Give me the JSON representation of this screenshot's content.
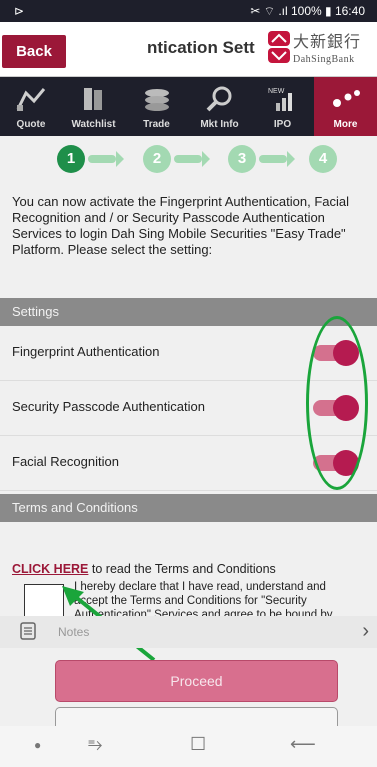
{
  "status": {
    "left": "⊳",
    "right": "✂ ⌔ .ıl 100% ▮ 16:40"
  },
  "header": {
    "back_label": "Back",
    "title": "ntication Sett",
    "brand_cn": "大新銀行",
    "brand_en": "DahSingBank"
  },
  "tabs": [
    {
      "label": "Quote"
    },
    {
      "label": "Watchlist"
    },
    {
      "label": "Trade"
    },
    {
      "label": "Mkt Info"
    },
    {
      "label": "IPO"
    },
    {
      "label": "More"
    }
  ],
  "steps": [
    "1",
    "2",
    "3",
    "4"
  ],
  "intro": "You can now activate the Fingerprint Authentication, Facial Recognition and / or Security Passcode Authentication Services to login Dah Sing Mobile Securities \"Easy Trade\" Platform. Please select the setting:",
  "settings": {
    "header": "Settings",
    "items": [
      {
        "label": "Fingerprint Authentication",
        "enabled": true
      },
      {
        "label": "Security Passcode Authentication",
        "enabled": true
      },
      {
        "label": "Facial Recognition",
        "enabled": true
      }
    ]
  },
  "terms": {
    "header": "Terms and Conditions",
    "click_here": "CLICK HERE",
    "read_text": " to read the Terms and Conditions",
    "declaration": "I hereby declare that I have read, understand and accept the Terms and Conditions for \"Security Authentication\" Services and agree to be bound by them."
  },
  "notes_label": "Notes",
  "proceed_label": "Proceed",
  "nav": {
    "recent": "⥱",
    "home": "☐",
    "back": "⟵"
  },
  "colors": {
    "brand": "#9b1838",
    "accent_pink": "#d86f8e",
    "highlight_green": "#1aa53b"
  }
}
